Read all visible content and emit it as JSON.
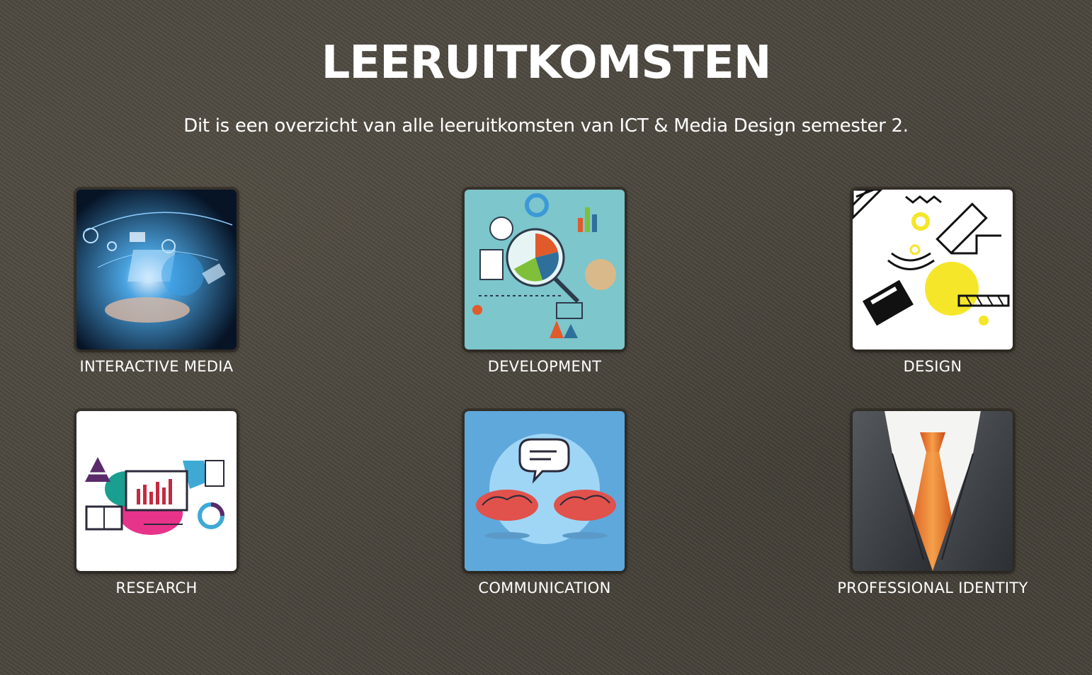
{
  "header": {
    "title": "LEERUITKOMSTEN",
    "subtitle": "Dit is een overzicht van alle leeruitkomsten van ICT & Media Design semester 2."
  },
  "cards": [
    {
      "label": "INTERACTIVE MEDIA",
      "icon": "interactive-media-illustration"
    },
    {
      "label": "DEVELOPMENT",
      "icon": "development-illustration"
    },
    {
      "label": "DESIGN",
      "icon": "design-illustration"
    },
    {
      "label": "RESEARCH",
      "icon": "research-illustration"
    },
    {
      "label": "COMMUNICATION",
      "icon": "communication-illustration"
    },
    {
      "label": "PROFESSIONAL IDENTITY",
      "icon": "professional-identity-illustration"
    }
  ],
  "colors": {
    "background": "#4a453c",
    "text": "#ffffff",
    "development_bg": "#7cc6cc",
    "communication_bg": "#5fa8dc",
    "design_accent": "#f5e62a"
  }
}
